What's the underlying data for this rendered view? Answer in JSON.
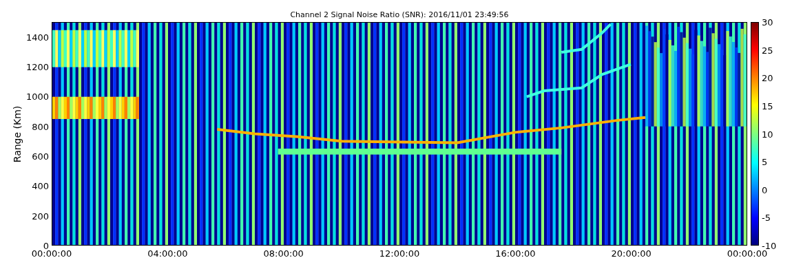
{
  "title": "Channel 2 Signal Noise Ratio (SNR): 2016/11/01 23:49:56",
  "y_axis": {
    "label": "Range (Km)",
    "ticks": [
      "1400",
      "1200",
      "1000",
      "800",
      "600",
      "400",
      "200",
      "0"
    ]
  },
  "x_axis": {
    "ticks": [
      "00:00:00",
      "04:00:00",
      "08:00:00",
      "12:00:00",
      "16:00:00",
      "20:00:00",
      "00:00:00"
    ]
  },
  "colorbar": {
    "ticks": [
      "30",
      "25",
      "20",
      "15",
      "10",
      "5",
      "0",
      "-5",
      "-10"
    ]
  }
}
